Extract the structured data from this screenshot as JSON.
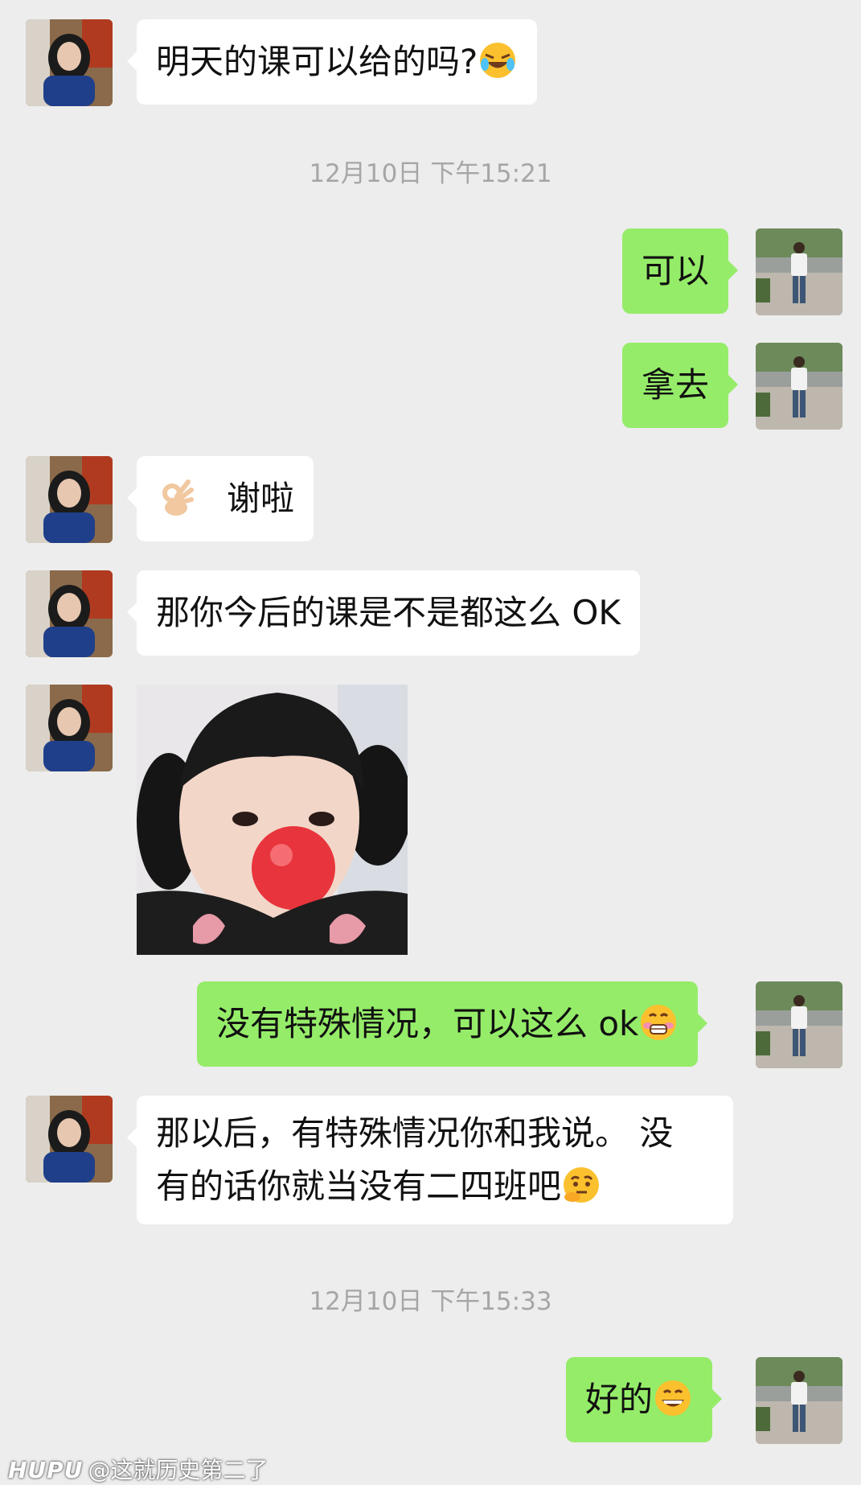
{
  "messages": [
    {
      "text": "明天的课可以给的吗?",
      "emoji": "laughing-crying-emoji"
    },
    {
      "text": "可以"
    },
    {
      "text": "拿去"
    },
    {
      "text": "谢啦",
      "emoji": "ok-hand-emoji"
    },
    {
      "text": "那你今后的课是不是都这么 OK"
    },
    {
      "sticker": "red-nose-girl-sticker"
    },
    {
      "text": "没有特殊情况，可以这么 ok",
      "emoji": "grinning-blush-emoji"
    },
    {
      "line1": "那以后，有特殊情况你和我说。 没",
      "line2": "有的话你就当没有二四班吧",
      "emoji": "thinking-emoji"
    },
    {
      "text": "好的",
      "emoji": "grin-emoji"
    }
  ],
  "timestamps": [
    "12月10日 下午15:21",
    "12月10日 下午15:33"
  ],
  "watermark": {
    "brand": "HUPU",
    "text": "@这就历史第二了"
  },
  "colors": {
    "background": "#ededed",
    "incoming_bubble": "#ffffff",
    "outgoing_bubble": "#95ec69"
  }
}
